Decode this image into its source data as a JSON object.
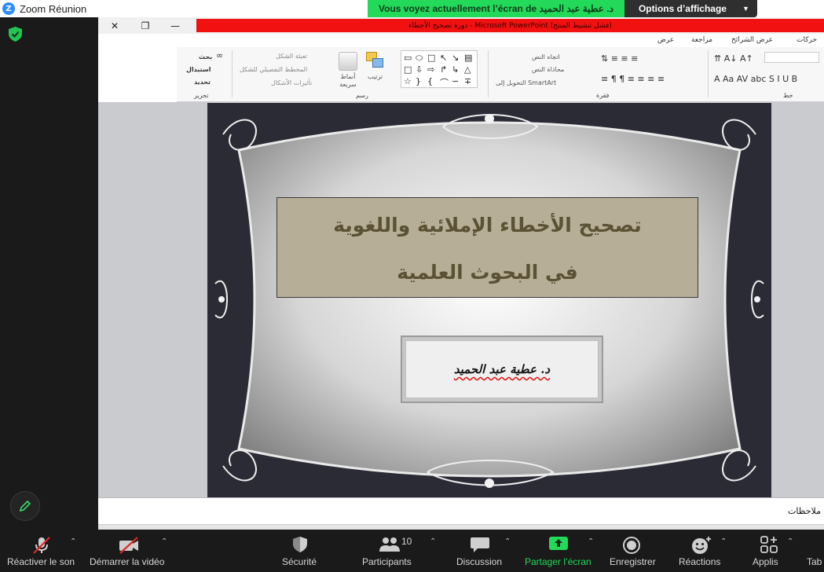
{
  "window": {
    "app_title": "Zoom Réunion",
    "share_banner": "Vous voyez actuellement l’écran de د. عطية عبد الحميد",
    "view_options": "Options d’affichage"
  },
  "powerpoint": {
    "title_bar": "دورة تصحيح الأخطاء - Microsoft PowerPoint (فشل تنشيط المنتج)",
    "menu_tabs": [
      "حركات",
      "عرض الشرائح",
      "مراجعة",
      "عرض"
    ],
    "ribbon": {
      "editing_group": "تحرير",
      "drawing_group": "رسم",
      "paragraph_group": "فقرة",
      "font_group": "خط",
      "find": "بحث",
      "replace": "استبدال",
      "select": "تحديد",
      "shape_fill": "تعبئة الشكل",
      "shape_outline": "المخطط التفصيلي للشكل",
      "shape_effects": "تأثيرات الأشكال",
      "quick_styles": "أنماط سريعة",
      "arrange": "ترتيب",
      "text_direction": "اتجاه النص",
      "align_text": "محاذاة النص",
      "convert_smartart": "التحويل إلى SmartArt"
    },
    "slide": {
      "title_line1": "تصحيح الأخطاء الإملائية واللغوية",
      "title_line2": "في البحوث العلمية",
      "author": "د. عطية عبد الحميد"
    },
    "notes_label": "ملاحظات"
  },
  "toolbar": {
    "unmute": "Réactiver le son",
    "start_video": "Démarrer la vidéo",
    "security": "Sécurité",
    "participants": "Participants",
    "participants_count": "10",
    "chat": "Discussion",
    "share_screen": "Partager l’écran",
    "record": "Enregistrer",
    "reactions": "Réactions",
    "apps": "Applis",
    "more": "Tab"
  },
  "colors": {
    "share_green": "#23d959",
    "title_bar_red": "#f21111",
    "slide_title_box": "#b6ae97",
    "toolbar_bg": "#1a1a1a"
  }
}
